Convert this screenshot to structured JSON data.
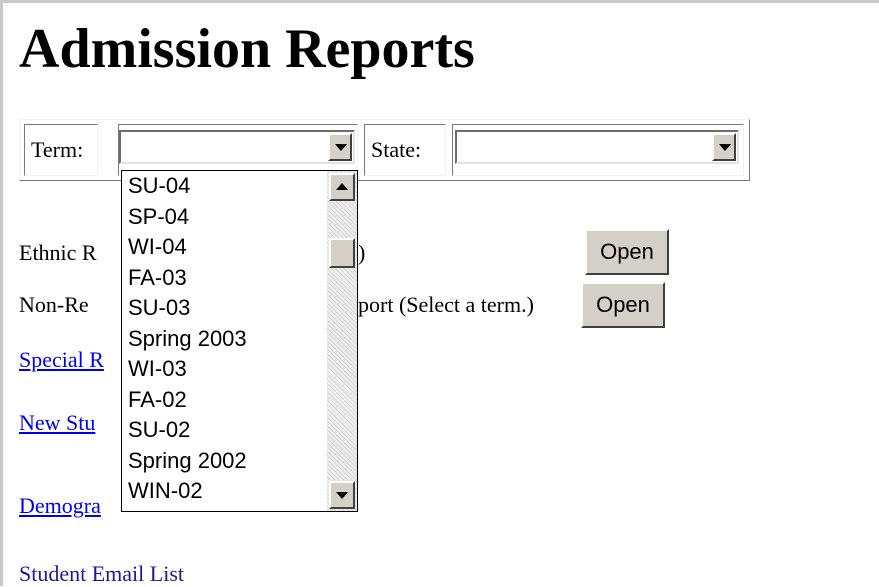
{
  "page": {
    "title": "Admission Reports"
  },
  "filters": {
    "term_label": "Term:",
    "term_value": "",
    "state_label": "State:",
    "state_value": ""
  },
  "term_dropdown": {
    "options": [
      "SU-04",
      "SP-04",
      "WI-04",
      "FA-03",
      "SU-03",
      "Spring 2003",
      "WI-03",
      "FA-02",
      "SU-02",
      "Spring 2002",
      "WIN-02"
    ]
  },
  "reports": {
    "ethnic": {
      "text_left": "Ethnic R",
      "text_right": ")",
      "button_label": "Open"
    },
    "nonres": {
      "text_left": "Non-Re",
      "text_right": "port (Select a term.)",
      "button_label": "Open"
    },
    "special_link": "Special R",
    "new_students_link": "New Stu",
    "demographic_link": "Demogra",
    "demographic_link_tail": "",
    "student_email_list": "Student Email List"
  }
}
